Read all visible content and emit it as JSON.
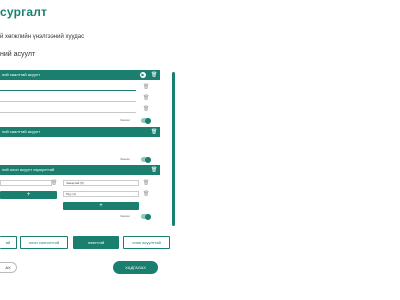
{
  "app": {
    "title": "сургалт"
  },
  "header": {
    "crumb": "...",
    "title": "й хөгжлийн үнэлгээний хуудас"
  },
  "section": {
    "title": "ний асуулт"
  },
  "cards": [
    {
      "title": "ний хаалттай асуулт",
      "answers": [
        "",
        "",
        ""
      ],
      "required_label": "Заавал",
      "required": true
    },
    {
      "title": "ний хаалттай асуулт",
      "required_label": "Заавал",
      "required": true
    },
    {
      "title": "ний олон асуулт хариулттай",
      "left_field": "",
      "right_fields": [
        "Чанартай (5)",
        "Муу (1)"
      ],
      "add_label": "+",
      "required_label": "Заавал",
      "required": true
    }
  ],
  "question_types": [
    {
      "label": "ай"
    },
    {
      "label": "олон сонголттой"
    },
    {
      "label": "нээлттэй"
    },
    {
      "label": "олон асуулттай"
    }
  ],
  "footer": {
    "back_label": "АХ",
    "save_label": "ХАДГАЛАХ"
  },
  "colors": {
    "accent": "#1a7f6e"
  }
}
